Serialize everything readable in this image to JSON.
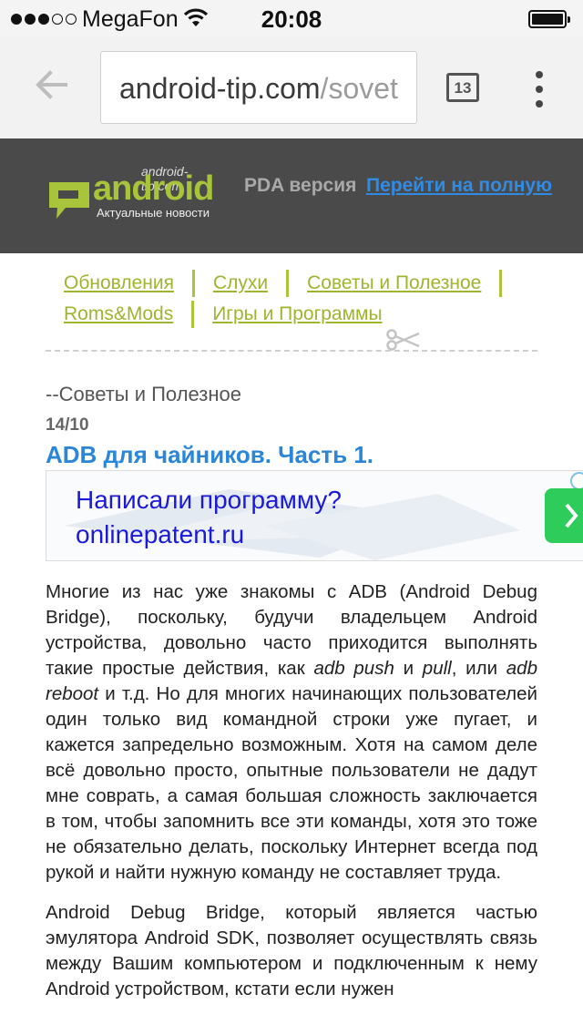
{
  "status_bar": {
    "carrier": "MegaFon",
    "time": "20:08",
    "signal_bars_filled": 3,
    "signal_bars_total": 5
  },
  "browser": {
    "url_host": "android-tip.com",
    "url_path": "/sovet",
    "tab_count": "13"
  },
  "site_header": {
    "logo": {
      "domain": "android-tip.com",
      "word": "android",
      "tagline": "Актуальные новости"
    },
    "pda_label": "PDA версия",
    "full_link": "Перейти на полную"
  },
  "nav": {
    "items": [
      "Обновления",
      "Слухи",
      "Советы и Полезное",
      "Roms&Mods",
      "Игры и Программы"
    ]
  },
  "post": {
    "category": "--Советы и Полезное",
    "date": "14/10",
    "title": "ADB для чайников. Часть 1."
  },
  "ad": {
    "line1": "Написали программу?",
    "line2": "onlinepatent.ru"
  },
  "article": {
    "p1": {
      "t1": "Многие из нас уже знакомы с ADB (Android Debug Bridge), поскольку, будучи владельцем Android устройства, довольно часто приходится выполнять такие простые действия, как ",
      "em1": "adb push",
      "t2": " и ",
      "em2": "pull",
      "t3": ", или ",
      "em3": "adb reboot",
      "t4": " и т.д. Но для многих начинающих пользователей один только вид командной строки уже пугает, и кажется запредельно возможным. Хотя на самом деле всё довольно просто, опытные пользователи не дадут мне соврать, а самая большая сложность заключается в том, чтобы запомнить все эти команды, хотя это тоже не обязательно делать, поскольку Интернет всегда под рукой и найти нужную команду не составляет труда."
    },
    "p2": "Android Debug Bridge, который является частью эмулятора Android SDK, позволяет осуществлять связь между Вашим компьютером и подключенным к нему Android устройством, кстати если нужен"
  },
  "colors": {
    "header_bg": "#4a4a4a",
    "logo_green": "#a8c43a",
    "nav_link": "#9eb52f",
    "title_blue": "#2a86d8",
    "link_blue": "#2f8be5",
    "ad_text": "#1a1ad8",
    "ad_button": "#2ecc5a"
  }
}
